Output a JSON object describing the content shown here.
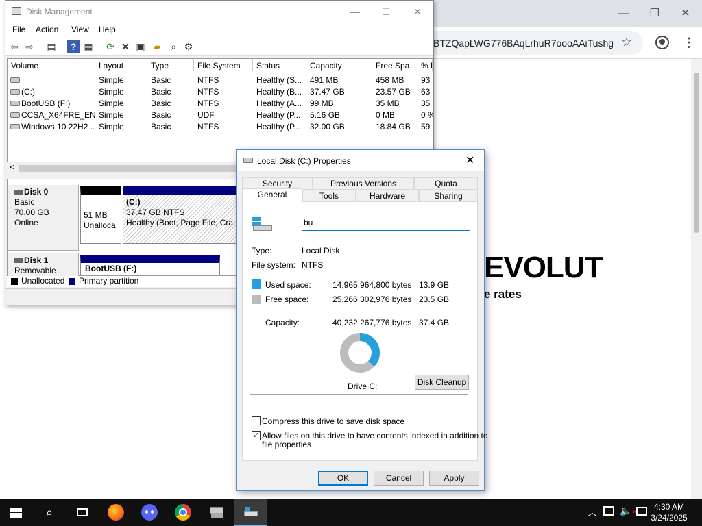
{
  "browser": {
    "url": "BTZQapLWG776BAqLrhuR7oooAAiTushg...",
    "brand": "EVOLUT",
    "brand_sub": "e rates",
    "min_icon": "—",
    "restore_icon": "❐",
    "close_icon": "✕"
  },
  "disk_mgmt": {
    "title": "Disk Management",
    "menu": [
      "File",
      "Action",
      "View",
      "Help"
    ],
    "columns": [
      "Volume",
      "Layout",
      "Type",
      "File System",
      "Status",
      "Capacity",
      "Free Spa...",
      "% F"
    ],
    "rows": [
      [
        "",
        "Simple",
        "Basic",
        "NTFS",
        "Healthy (S...",
        "491 MB",
        "458 MB",
        "93"
      ],
      [
        "(C:)",
        "Simple",
        "Basic",
        "NTFS",
        "Healthy (B...",
        "37.47 GB",
        "23.57 GB",
        "63"
      ],
      [
        "BootUSB (F:)",
        "Simple",
        "Basic",
        "NTFS",
        "Healthy (A...",
        "99 MB",
        "35 MB",
        "35"
      ],
      [
        "CCSA_X64FRE_EN-...",
        "Simple",
        "Basic",
        "UDF",
        "Healthy (P...",
        "5.16 GB",
        "0 MB",
        "0 %"
      ],
      [
        "Windows 10 22H2 ...",
        "Simple",
        "Basic",
        "NTFS",
        "Healthy (P...",
        "32.00 GB",
        "18.84 GB",
        "59"
      ]
    ],
    "disk0": {
      "name": "Disk 0",
      "type": "Basic",
      "size": "70.00 GB",
      "state": "Online",
      "unalloc_size": "51 MB",
      "unalloc_label": "Unalloca",
      "c_name": "(C:)",
      "c_size": "37.47 GB NTFS",
      "c_status": "Healthy (Boot, Page File, Cra"
    },
    "disk1": {
      "name": "Disk 1",
      "type": "Removable",
      "part_name": "BootUSB (F:)"
    },
    "legend": {
      "unallocated": "Unallocated",
      "primary": "Primary partition"
    },
    "scroll_left": "<"
  },
  "dialog": {
    "title": "Local Disk (C:) Properties",
    "tabs_row1": [
      "Security",
      "Previous Versions",
      "Quota"
    ],
    "tabs_row2": [
      "General",
      "Tools",
      "Hardware",
      "Sharing"
    ],
    "name_value": "bu",
    "type_label": "Type:",
    "type_value": "Local Disk",
    "fs_label": "File system:",
    "fs_value": "NTFS",
    "used_label": "Used space:",
    "used_bytes": "14,965,964,800 bytes",
    "used_gb": "13.9 GB",
    "free_label": "Free space:",
    "free_bytes": "25,266,302,976 bytes",
    "free_gb": "23.5 GB",
    "cap_label": "Capacity:",
    "cap_bytes": "40,232,267,776 bytes",
    "cap_gb": "37.4 GB",
    "drive_label": "Drive C:",
    "cleanup": "Disk Cleanup",
    "compress": "Compress this drive to save disk space",
    "index_line1": "Allow files on this drive to have contents indexed in addition to",
    "index_line2": "file properties",
    "ok": "OK",
    "cancel": "Cancel",
    "apply": "Apply",
    "used_fraction": 0.372,
    "used_color": "#26a0da",
    "free_color": "#bcbcbc"
  },
  "taskbar": {
    "time": "4:30 AM",
    "date": "3/24/2025"
  }
}
